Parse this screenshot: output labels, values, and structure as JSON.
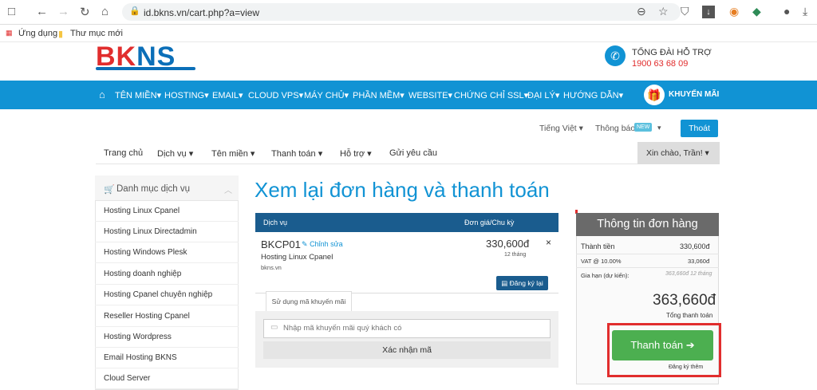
{
  "browser": {
    "url": "id.bkns.vn/cart.php?a=view",
    "bookmarks": [
      "Ứng dụng",
      "Thư mục mới"
    ]
  },
  "header": {
    "logo_bk": "BK",
    "logo_ns": "NS",
    "support_title": "TỔNG ĐÀI HỖ TRỢ",
    "support_phone": "1900 63 68 09",
    "nav": [
      "TÊN MIỀN",
      "HOSTING",
      "EMAIL",
      "CLOUD VPS",
      "MÁY CHỦ",
      "PHẦN MỀM",
      "WEBSITE",
      "CHỨNG CHỈ SSL",
      "ĐẠI LÝ",
      "HƯỚNG DẪN"
    ],
    "promo": "KHUYẾN MÃI"
  },
  "utility": {
    "language": "Tiếng Việt",
    "notifications": "Thông báo",
    "new_badge": "NEW",
    "logout": "Thoát"
  },
  "subnav": {
    "items": [
      "Trang chủ",
      "Dịch vụ",
      "Tên miền",
      "Thanh toán",
      "Hỗ trợ",
      "Gửi yêu cầu"
    ],
    "greeting": "Xin chào, Trần!"
  },
  "sidebar": {
    "title": "Danh mục dịch vụ",
    "items": [
      "Hosting Linux Cpanel",
      "Hosting Linux Directadmin",
      "Hosting Windows Plesk",
      "Hosting doanh nghiệp",
      "Hosting Cpanel chuyên nghiệp",
      "Reseller Hosting Cpanel",
      "Hosting Wordpress",
      "Email Hosting BKNS",
      "Cloud Server"
    ]
  },
  "cart": {
    "title": "Xem lại đơn hàng và thanh toán",
    "col_service": "Dịch vụ",
    "col_price": "Đơn giá/Chu kỳ",
    "item": {
      "name": "BKCP01",
      "edit": "Chỉnh sửa",
      "desc": "Hosting Linux Cpanel",
      "domain": "bkns.vn",
      "price": "330,600đ",
      "period": "12 tháng",
      "remove": "×"
    },
    "renew_button": "Đăng ký lại",
    "promo_tab": "Sử dụng mã khuyến mãi",
    "promo_placeholder": "Nhập mã khuyến mãi quý khách có",
    "promo_submit": "Xác nhận mã"
  },
  "summary": {
    "title": "Thông tin đơn hàng",
    "subtotal_label": "Thành tiền",
    "subtotal": "330,600đ",
    "vat_label": "VAT @ 10.00%",
    "vat": "33,060đ",
    "renew_label": "Gia hạn (dự kiến):",
    "renew_value": "363,660đ 12 tháng",
    "total": "363,660đ",
    "total_label": "Tổng thanh toán",
    "pay_button": "Thanh toán",
    "pay_note": "Đăng ký thêm"
  }
}
